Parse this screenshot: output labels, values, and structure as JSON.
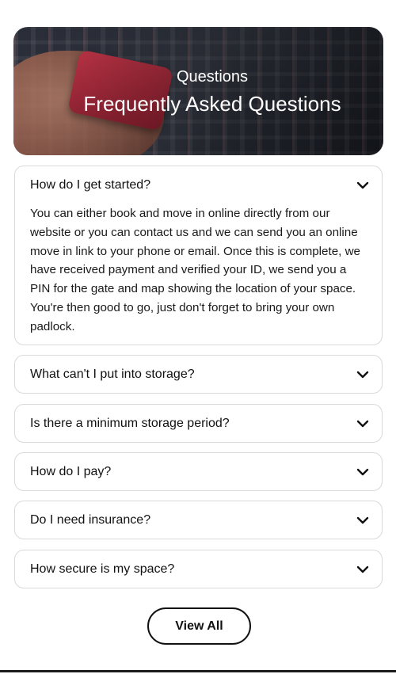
{
  "hero": {
    "eyebrow": "Questions",
    "title": "Frequently Asked Questions"
  },
  "faq": {
    "items": [
      {
        "question": "How do I get started?",
        "expanded": true,
        "answer": "You can either book and move in online directly from our website or you can contact us and we can send you an online move in link to your phone or email. Once this is complete, we have received payment and verified your ID, we send you a PIN for the gate and map showing the location of your space. You're then good to go, just don't forget to bring your own padlock."
      },
      {
        "question": "What can't I put into storage?",
        "expanded": false
      },
      {
        "question": "Is there a minimum storage period?",
        "expanded": false
      },
      {
        "question": "How do I pay?",
        "expanded": false
      },
      {
        "question": "Do I need insurance?",
        "expanded": false
      },
      {
        "question": "How secure is my space?",
        "expanded": false
      }
    ],
    "chevron_icon": "chevron-down-icon"
  },
  "footer": {
    "view_all_label": "View All"
  }
}
